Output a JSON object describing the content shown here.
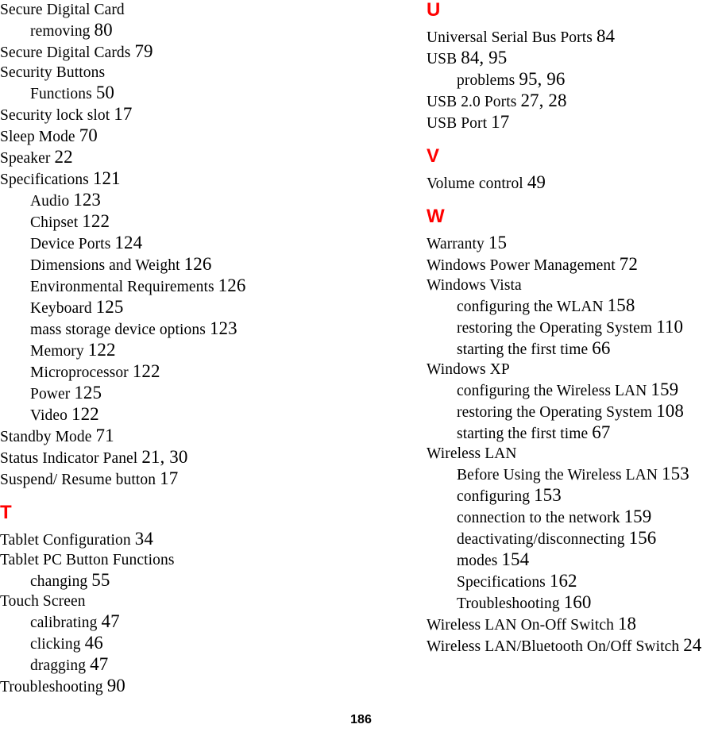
{
  "document": {
    "type": "index",
    "page_number": "186"
  },
  "left_column": [
    {
      "kind": "entry",
      "level": 0,
      "text": "Secure Digital Card",
      "pages": ""
    },
    {
      "kind": "entry",
      "level": 1,
      "text": "removing",
      "pages": "80"
    },
    {
      "kind": "entry",
      "level": 0,
      "text": "Secure Digital Cards",
      "pages": "79"
    },
    {
      "kind": "entry",
      "level": 0,
      "text": "Security Buttons",
      "pages": ""
    },
    {
      "kind": "entry",
      "level": 1,
      "text": "Functions",
      "pages": "50"
    },
    {
      "kind": "entry",
      "level": 0,
      "text": "Security lock slot",
      "pages": "17"
    },
    {
      "kind": "entry",
      "level": 0,
      "text": "Sleep Mode",
      "pages": "70"
    },
    {
      "kind": "entry",
      "level": 0,
      "text": "Speaker",
      "pages": "22"
    },
    {
      "kind": "entry",
      "level": 0,
      "text": "Specifications",
      "pages": "121"
    },
    {
      "kind": "entry",
      "level": 1,
      "text": "Audio",
      "pages": "123"
    },
    {
      "kind": "entry",
      "level": 1,
      "text": "Chipset",
      "pages": "122"
    },
    {
      "kind": "entry",
      "level": 1,
      "text": "Device Ports",
      "pages": "124"
    },
    {
      "kind": "entry",
      "level": 1,
      "text": "Dimensions and Weight",
      "pages": "126"
    },
    {
      "kind": "entry",
      "level": 1,
      "text": "Environmental Requirements",
      "pages": "126"
    },
    {
      "kind": "entry",
      "level": 1,
      "text": "Keyboard",
      "pages": "125"
    },
    {
      "kind": "entry",
      "level": 1,
      "text": "mass storage device options",
      "pages": "123"
    },
    {
      "kind": "entry",
      "level": 1,
      "text": "Memory",
      "pages": "122"
    },
    {
      "kind": "entry",
      "level": 1,
      "text": "Microprocessor",
      "pages": "122"
    },
    {
      "kind": "entry",
      "level": 1,
      "text": "Power",
      "pages": "125"
    },
    {
      "kind": "entry",
      "level": 1,
      "text": "Video",
      "pages": "122"
    },
    {
      "kind": "entry",
      "level": 0,
      "text": "Standby Mode",
      "pages": "71"
    },
    {
      "kind": "entry",
      "level": 0,
      "text": "Status Indicator Panel",
      "pages": "21, 30"
    },
    {
      "kind": "entry",
      "level": 0,
      "text": "Suspend/ Resume button",
      "pages": "17"
    },
    {
      "kind": "head",
      "text": "T"
    },
    {
      "kind": "entry",
      "level": 0,
      "text": "Tablet Configuration",
      "pages": "34"
    },
    {
      "kind": "entry",
      "level": 0,
      "text": "Tablet PC Button Functions",
      "pages": ""
    },
    {
      "kind": "entry",
      "level": 1,
      "text": "changing",
      "pages": "55"
    },
    {
      "kind": "entry",
      "level": 0,
      "text": "Touch Screen",
      "pages": ""
    },
    {
      "kind": "entry",
      "level": 1,
      "text": "calibrating",
      "pages": "47"
    },
    {
      "kind": "entry",
      "level": 1,
      "text": "clicking",
      "pages": "46"
    },
    {
      "kind": "entry",
      "level": 1,
      "text": "dragging",
      "pages": "47"
    },
    {
      "kind": "entry",
      "level": 0,
      "text": "Troubleshooting",
      "pages": "90"
    }
  ],
  "right_column": [
    {
      "kind": "head",
      "text": "U",
      "first": true
    },
    {
      "kind": "entry",
      "level": 0,
      "text": "Universal Serial Bus Ports",
      "pages": "84"
    },
    {
      "kind": "entry",
      "level": 0,
      "text": "USB",
      "pages": "84, 95"
    },
    {
      "kind": "entry",
      "level": 1,
      "text": "problems",
      "pages": "95, 96"
    },
    {
      "kind": "entry",
      "level": 0,
      "text": "USB 2.0 Ports",
      "pages": "27, 28"
    },
    {
      "kind": "entry",
      "level": 0,
      "text": "USB Port",
      "pages": "17"
    },
    {
      "kind": "head",
      "text": "V"
    },
    {
      "kind": "entry",
      "level": 0,
      "text": "Volume control",
      "pages": "49"
    },
    {
      "kind": "head",
      "text": "W"
    },
    {
      "kind": "entry",
      "level": 0,
      "text": "Warranty",
      "pages": "15"
    },
    {
      "kind": "entry",
      "level": 0,
      "text": "Windows Power Management",
      "pages": "72"
    },
    {
      "kind": "entry",
      "level": 0,
      "text": "Windows Vista",
      "pages": ""
    },
    {
      "kind": "entry",
      "level": 1,
      "text": "configuring the WLAN",
      "pages": "158"
    },
    {
      "kind": "entry",
      "level": 1,
      "text": "restoring the Operating System",
      "pages": "110"
    },
    {
      "kind": "entry",
      "level": 1,
      "text": "starting the first time",
      "pages": "66"
    },
    {
      "kind": "entry",
      "level": 0,
      "text": "Windows XP",
      "pages": ""
    },
    {
      "kind": "entry",
      "level": 1,
      "text": "configuring the Wireless LAN",
      "pages": "159"
    },
    {
      "kind": "entry",
      "level": 1,
      "text": "restoring the Operating System",
      "pages": "108"
    },
    {
      "kind": "entry",
      "level": 1,
      "text": "starting the first time",
      "pages": "67"
    },
    {
      "kind": "entry",
      "level": 0,
      "text": "Wireless LAN",
      "pages": ""
    },
    {
      "kind": "entry",
      "level": 1,
      "text": "Before Using the Wireless LAN",
      "pages": "153"
    },
    {
      "kind": "entry",
      "level": 1,
      "text": "configuring",
      "pages": "153"
    },
    {
      "kind": "entry",
      "level": 1,
      "text": "connection to the network",
      "pages": "159"
    },
    {
      "kind": "entry",
      "level": 1,
      "text": "deactivating/disconnecting",
      "pages": "156"
    },
    {
      "kind": "entry",
      "level": 1,
      "text": "modes",
      "pages": "154"
    },
    {
      "kind": "entry",
      "level": 1,
      "text": "Specifications",
      "pages": "162"
    },
    {
      "kind": "entry",
      "level": 1,
      "text": "Troubleshooting",
      "pages": "160"
    },
    {
      "kind": "entry",
      "level": 0,
      "text": "Wireless LAN On-Off Switch",
      "pages": "18"
    },
    {
      "kind": "entry",
      "level": 0,
      "text": "Wireless LAN/Bluetooth On/Off Switch",
      "pages": "24"
    }
  ],
  "colors": {
    "section_head": "#ff0000",
    "text": "#000000",
    "background": "#ffffff"
  }
}
